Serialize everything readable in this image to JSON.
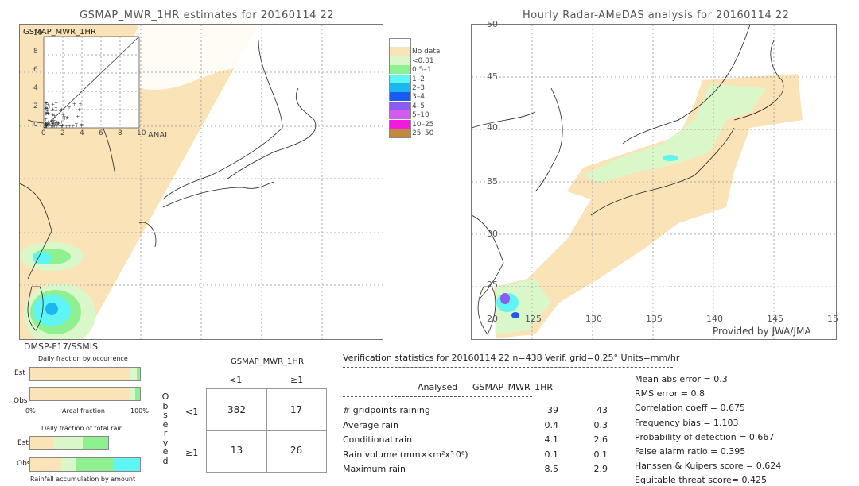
{
  "chart_data": [
    {
      "type": "heatmap",
      "title": "GSMAP_MWR_1HR estimates for 20160114 22",
      "description": "Map of estimated hourly rainfall over Japan region; swath boundary diagonal, no-data east of swath",
      "inset": {
        "title": "GSMAP_MWR_1HR",
        "type": "scatter",
        "xlabel": "ANAL",
        "x_ticks": [
          "0",
          "2",
          "4",
          "6",
          "8",
          "10"
        ],
        "y_ticks": [
          "0",
          "2",
          "4",
          "6",
          "8",
          "10"
        ],
        "xlim": [
          0,
          10
        ],
        "ylim": [
          0,
          10
        ]
      }
    },
    {
      "type": "heatmap",
      "title": "Hourly Radar-AMeDAS analysis for 20160114 22",
      "lat_ticks": [
        "20",
        "25",
        "30",
        "35",
        "40",
        "45",
        "50"
      ],
      "lon_ticks": [
        "125",
        "130",
        "135",
        "140",
        "145",
        "15"
      ],
      "lon_first_label": "20",
      "credit": "Provided by JWA/JMA"
    }
  ],
  "legend": {
    "items": [
      {
        "label": "",
        "color": "#ffffff"
      },
      {
        "label": "No data",
        "color": "#fbe3b8"
      },
      {
        "label": "<0.01",
        "color": "#d9f7c8"
      },
      {
        "label": "0.5–1",
        "color": "#8ef08e"
      },
      {
        "label": "1–2",
        "color": "#5ff5f5"
      },
      {
        "label": "2–3",
        "color": "#19b8f0"
      },
      {
        "label": "3–4",
        "color": "#1a5cf0"
      },
      {
        "label": "4–5",
        "color": "#8a5cf0"
      },
      {
        "label": "5–10",
        "color": "#d25cf0"
      },
      {
        "label": "10–25",
        "color": "#f01ae0"
      },
      {
        "label": "25–50",
        "color": "#c08a3a"
      }
    ]
  },
  "satellite": "DMSP-F17/SSMIS",
  "occurrence": {
    "title": "Daily fraction by occurrence",
    "est_label": "Est",
    "obs_label": "Obs",
    "x_left": "0%",
    "x_mid": "Areal fraction",
    "x_right": "100%",
    "est_segments": [
      {
        "fraction": 0.91,
        "color": "#fbe3b8"
      },
      {
        "fraction": 0.06,
        "color": "#d9f7c8"
      },
      {
        "fraction": 0.03,
        "color": "#8ef08e"
      }
    ],
    "obs_segments": [
      {
        "fraction": 0.91,
        "color": "#fbe3b8"
      },
      {
        "fraction": 0.05,
        "color": "#d9f7c8"
      },
      {
        "fraction": 0.03,
        "color": "#8ef08e"
      },
      {
        "fraction": 0.01,
        "color": "#5ff5f5"
      }
    ]
  },
  "total_rain": {
    "title": "Daily fraction of total rain",
    "est_label": "Est",
    "obs_label": "Obs",
    "footer": "Rainfall accumulation by amount",
    "est_segments": [
      {
        "fraction": 0.3,
        "color": "#fbe3b8"
      },
      {
        "fraction": 0.37,
        "color": "#d9f7c8"
      },
      {
        "fraction": 0.33,
        "color": "#8ef08e"
      }
    ],
    "obs_segments": [
      {
        "fraction": 0.28,
        "color": "#fbe3b8"
      },
      {
        "fraction": 0.14,
        "color": "#d9f7c8"
      },
      {
        "fraction": 0.34,
        "color": "#8ef08e"
      },
      {
        "fraction": 0.24,
        "color": "#5ff5f5"
      }
    ]
  },
  "contingency": {
    "title": "GSMAP_MWR_1HR",
    "col_labels": [
      "<1",
      "≥1"
    ],
    "row_labels": [
      "<1",
      "≥1"
    ],
    "side_label": "Observed",
    "cells": [
      [
        "382",
        "17"
      ],
      [
        "13",
        "26"
      ]
    ]
  },
  "verification": {
    "header": "Verification statistics for 20160114 22   n=438   Verif. grid=0.25°   Units=mm/hr",
    "col_analysed": "Analysed",
    "col_gsmap": "GSMAP_MWR_1HR",
    "rows": [
      {
        "label": "# gridpoints raining",
        "analysed": "39",
        "gsmap": "43"
      },
      {
        "label": "Average rain",
        "analysed": "0.4",
        "gsmap": "0.3"
      },
      {
        "label": "Conditional rain",
        "analysed": "4.1",
        "gsmap": "2.6"
      },
      {
        "label": "Rain volume (mm×km²x10⁶)",
        "analysed": "0.1",
        "gsmap": "0.1"
      },
      {
        "label": "Maximum rain",
        "analysed": "8.5",
        "gsmap": "2.9"
      }
    ],
    "scores": [
      "Mean abs error = 0.3",
      "RMS error = 0.8",
      "Correlation coeff = 0.675",
      "Frequency bias = 1.103",
      "Probability of detection = 0.667",
      "False alarm ratio = 0.395",
      "Hanssen & Kuipers score = 0.624",
      "Equitable threat score= 0.425"
    ]
  }
}
